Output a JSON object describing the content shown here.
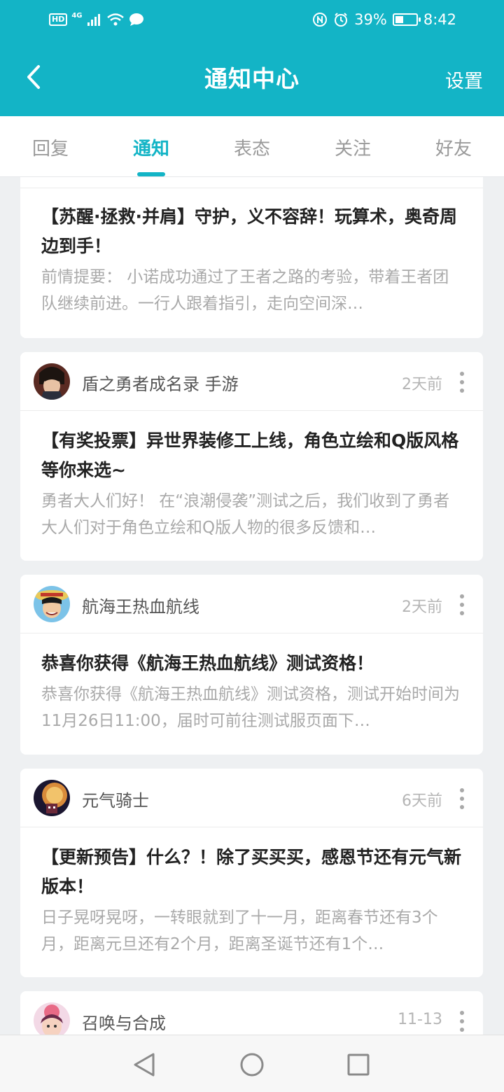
{
  "status_bar": {
    "hd": "HD",
    "network": "4G",
    "battery_percent": "39%",
    "battery_level": 0.39,
    "time": "8:42"
  },
  "header": {
    "title": "通知中心",
    "settings_label": "设置"
  },
  "tabs": [
    {
      "label": "回复",
      "active": false
    },
    {
      "label": "通知",
      "active": true
    },
    {
      "label": "表态",
      "active": false
    },
    {
      "label": "关注",
      "active": false
    },
    {
      "label": "好友",
      "active": false
    }
  ],
  "cards": [
    {
      "title": "【苏醒·拯救·并肩】守护，义不容辞！玩算术，奥奇周边到手！",
      "desc": "前情提要： 小诺成功通过了王者之路的考验，带着王者团队继续前进。一行人跟着指引，走向空间深…"
    },
    {
      "source": "盾之勇者成名录 手游",
      "time": "2天前",
      "title": "【有奖投票】异世界装修工上线，角色立绘和Q版风格等你来选~",
      "desc": "勇者大人们好！ 在“浪潮侵袭”测试之后，我们收到了勇者大人们对于角色立绘和Q版人物的很多反馈和…"
    },
    {
      "source": "航海王热血航线",
      "time": "2天前",
      "title": "恭喜你获得《航海王热血航线》测试资格！",
      "desc": "恭喜你获得《航海王热血航线》测试资格，测试开始时间为11月26日11:00，届时可前往测试服页面下…"
    },
    {
      "source": "元气骑士",
      "time": "6天前",
      "title": "【更新预告】什么？！除了买买买，感恩节还有元气新版本！",
      "desc": "日子晃呀晃呀，一转眼就到了十一月，距离春节还有3个月，距离元旦还有2个月，距离圣诞节还有1个…"
    },
    {
      "source": "召唤与合成",
      "time": "11-13"
    }
  ],
  "colors": {
    "accent": "#13b4c6",
    "background": "#eef0f2"
  }
}
